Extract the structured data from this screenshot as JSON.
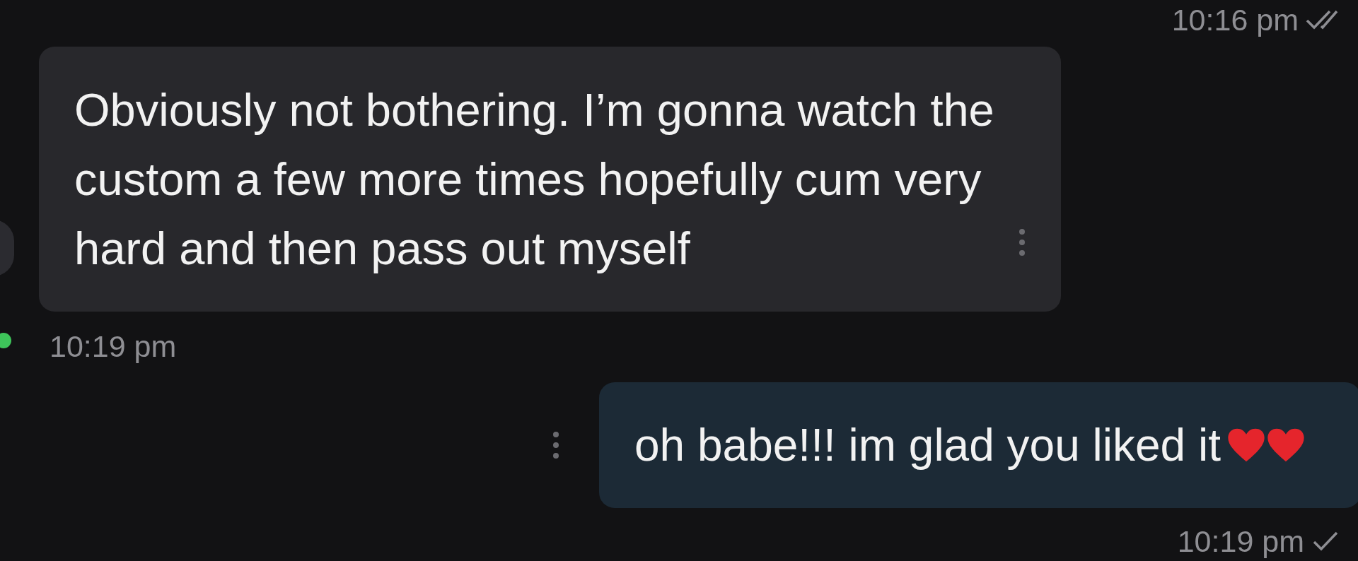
{
  "messages": [
    {
      "kind": "time",
      "time": "10:16 pm",
      "read": true
    },
    {
      "kind": "incoming",
      "text": "Obviously not bothering. I’m gonna watch the custom a few more times hopefully cum very hard and then pass out myself",
      "time": "10:19 pm",
      "online": true
    },
    {
      "kind": "outgoing",
      "text": "oh babe!!! im glad you liked it",
      "emoji": [
        {
          "kind": "heart"
        },
        {
          "kind": "heart"
        }
      ],
      "time": "10:19 pm",
      "read": false
    }
  ]
}
